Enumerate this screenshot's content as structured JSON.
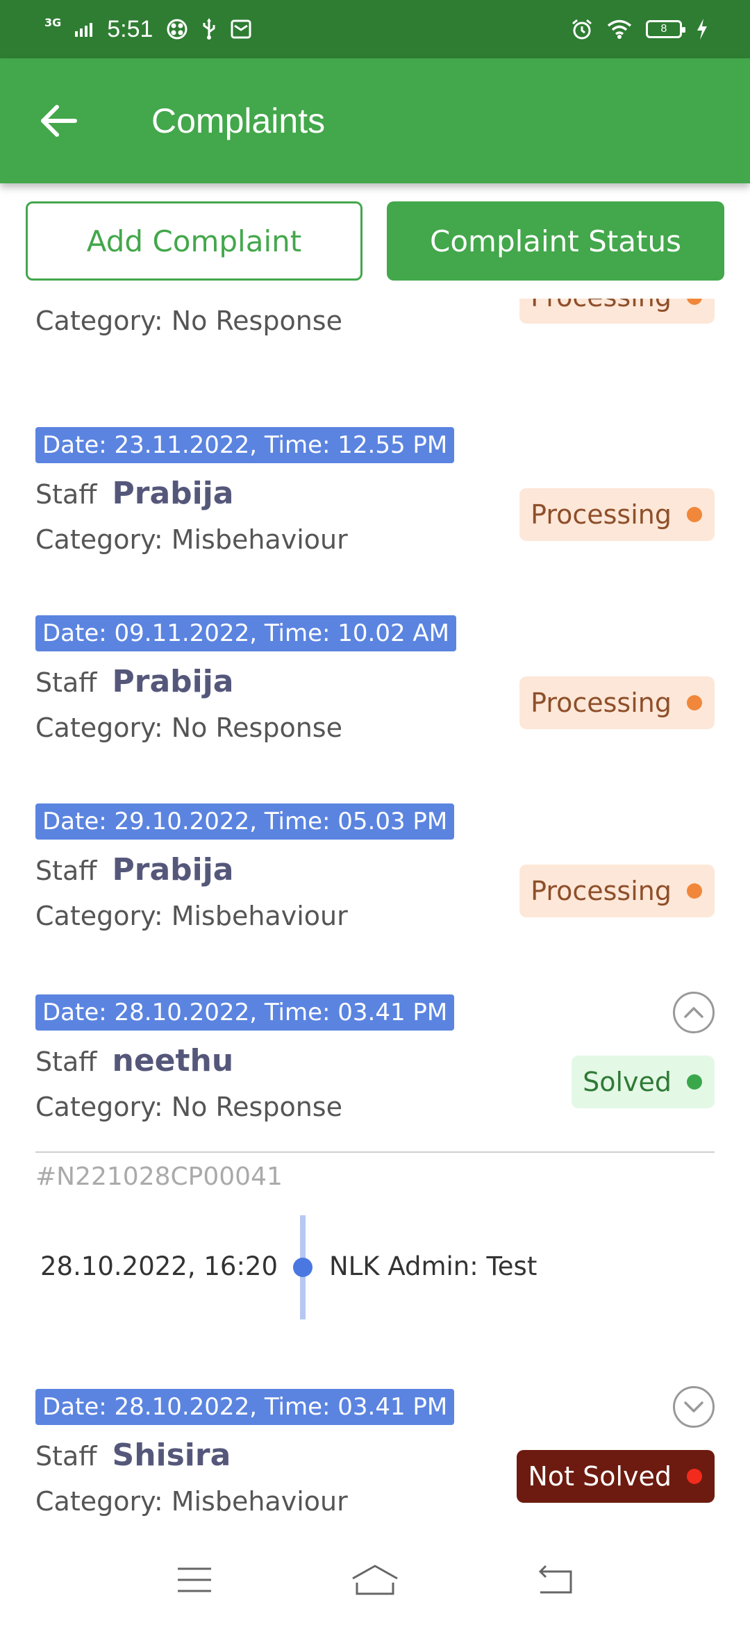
{
  "status_bar": {
    "network": "3G",
    "time": "5:51",
    "battery": "8"
  },
  "header": {
    "title": "Complaints"
  },
  "actions": {
    "add_label": "Add Complaint",
    "status_label": "Complaint Status"
  },
  "complaints": [
    {
      "category": "Category: No Response",
      "status": "Processing"
    },
    {
      "date": "Date: 23.11.2022, Time: 12.55 PM",
      "staff_label": "Staff",
      "staff_name": "Prabija",
      "category": "Category: Misbehaviour",
      "status": "Processing"
    },
    {
      "date": "Date: 09.11.2022, Time: 10.02 AM",
      "staff_label": "Staff",
      "staff_name": "Prabija",
      "category": "Category: No Response",
      "status": "Processing"
    },
    {
      "date": "Date: 29.10.2022, Time: 05.03 PM",
      "staff_label": "Staff",
      "staff_name": "Prabija",
      "category": "Category: Misbehaviour",
      "status": "Processing"
    },
    {
      "date": "Date: 28.10.2022, Time: 03.41 PM",
      "staff_label": "Staff",
      "staff_name": "neethu",
      "category": "Category: No Response",
      "status": "Solved",
      "expanded": true,
      "ref": "#N221028CP00041",
      "timeline": [
        {
          "datetime": "28.10.2022, 16:20",
          "text": "NLK Admin: Test"
        }
      ]
    },
    {
      "date": "Date: 28.10.2022, Time: 03.41 PM",
      "staff_label": "Staff",
      "staff_name": "Shisira",
      "category": "Category: Misbehaviour",
      "status": "Not Solved",
      "expanded": false
    }
  ],
  "colors": {
    "primary_green": "#43a74b",
    "status_bar_green": "#2e7d32",
    "date_chip_blue": "#5b84e0",
    "processing_bg": "#fde7d8",
    "solved_bg": "#e4f8e6",
    "not_solved_bg": "#6d1b10"
  }
}
